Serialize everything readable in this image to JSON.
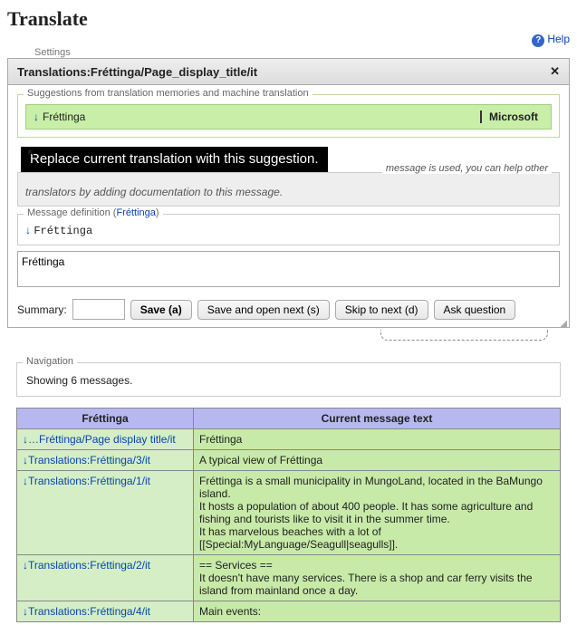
{
  "page_title": "Translate",
  "help_label": "Help",
  "settings_partial": "Settings",
  "dialog": {
    "title": "Translations:Fréttinga/Page_display_title/it",
    "close_glyph": "✕",
    "suggestions_label": "Suggestions from translation memories and machine translation",
    "suggestion_text": "Fréttinga",
    "suggestion_source": "Microsoft",
    "arrow": "↓",
    "tooltip": "Replace current translation with this suggestion.",
    "doc_trail": " message is used, you can help other",
    "doc_line2": "translators by adding documentation to this message.",
    "def_label_prefix": "Message definition (",
    "def_link": "Fréttinga",
    "def_label_suffix": ")",
    "def_text": "Fréttinga",
    "textarea_value": "Fréttinga",
    "summary_label": "Summary:",
    "save": "Save (a)",
    "save_next": "Save and open next (s)",
    "skip": "Skip to next (d)",
    "ask": "Ask question"
  },
  "nav": {
    "label": "Navigation",
    "text": "Showing 6 messages."
  },
  "table": {
    "col1": "Fréttinga",
    "col2": "Current message text",
    "rows": [
      {
        "key": "↓…Fréttinga/Page display title/it",
        "val": "Fréttinga"
      },
      {
        "key": "↓Translations:Fréttinga/3/it",
        "val": "A typical view of Fréttinga"
      },
      {
        "key": "↓Translations:Fréttinga/1/it",
        "val": "Fréttinga is a small municipality in MungoLand, located in the BaMungo island.\nIt hosts a population of about 400 people.  It has some agriculture and fishing and tourists like to visit it in the summer time.\nIt has marvelous beaches with a lot of [[Special:MyLanguage/Seagull|seagulls]]."
      },
      {
        "key": "↓Translations:Fréttinga/2/it",
        "val": "== Services ==\nIt doesn't have many services. There is a shop and car ferry visits the island from mainland once a day."
      },
      {
        "key": "↓Translations:Fréttinga/4/it",
        "val": "Main events:"
      }
    ]
  }
}
